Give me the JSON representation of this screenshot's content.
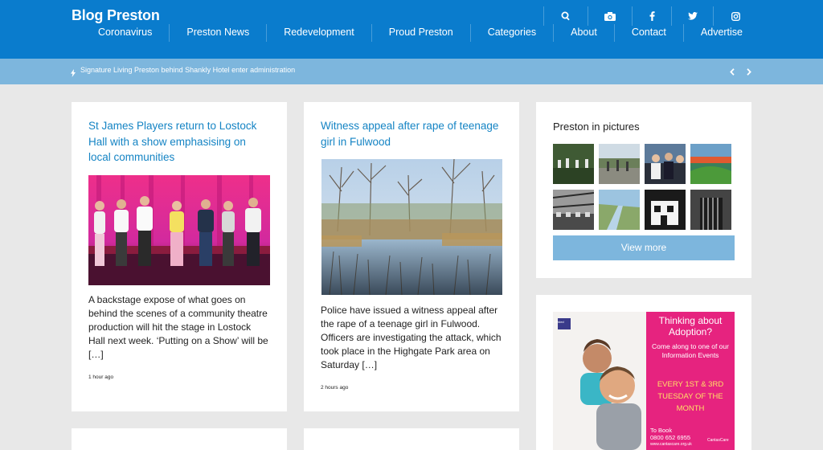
{
  "site": {
    "title": "Blog Preston"
  },
  "nav": {
    "items": [
      "Coronavirus",
      "Preston News",
      "Redevelopment",
      "Proud Preston",
      "Categories",
      "About",
      "Contact",
      "Advertise"
    ]
  },
  "header_icons": [
    "search-icon",
    "camera-icon",
    "facebook-icon",
    "twitter-icon",
    "instagram-icon"
  ],
  "ticker": {
    "headline": "Signature Living Preston behind Shankly Hotel enter administration"
  },
  "articles": [
    {
      "title": "St James Players return to Lostock Hall with a show emphasising on local communities",
      "excerpt": "A backstage expose of what goes on behind the scenes of a community theatre production will hit the stage in Lostock Hall next week. ‘Putting on a Show’ will be […]",
      "time": "1 hour ago"
    },
    {
      "title": "Witness appeal after rape of teenage girl in Fulwood",
      "excerpt": "Police have issued a witness appeal after the rape of a teenage girl in Fulwood. Officers are investigating the attack, which took place in the Highgate Park area on Saturday […]",
      "time": "2 hours ago"
    }
  ],
  "gallery": {
    "title": "Preston in pictures",
    "button": "View more"
  },
  "advert": {
    "heading_1": "Thinking about",
    "heading_2": "Adoption?",
    "body": "Come along to one of our Information Events",
    "highlight": "EVERY 1ST & 3RD TUESDAY OF THE MONTH",
    "book_label": "To Book",
    "phone": "0800 652 6955",
    "brand": "CantasCare",
    "web": "www.cantascare.org.uk",
    "ofsted": "Ofsted"
  },
  "colors": {
    "brand_blue": "#0a7ccd",
    "ticker_blue": "#7db6dd",
    "link_blue": "#1584c4",
    "advert_pink": "#e6237f"
  }
}
